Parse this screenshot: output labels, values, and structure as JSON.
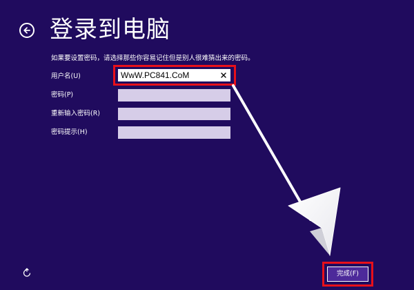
{
  "header": {
    "title": "登录到电脑"
  },
  "form": {
    "hint": "如果要设置密码，请选择那些你容易记住但是别人很难猜出来的密码。",
    "username_label": "用户名(U)",
    "username_value": "WwW.PC841.CoM",
    "password_label": "密码(P)",
    "password_value": "",
    "reenter_label": "重新输入密码(R)",
    "reenter_value": "",
    "hint_label": "密码提示(H)",
    "hint_value": ""
  },
  "footer": {
    "finish_label": "完成(F)"
  },
  "icons": {
    "back": "back-arrow-icon",
    "clear": "close-icon",
    "ease_of_access": "ease-of-access-icon"
  },
  "colors": {
    "background": "#200b5e",
    "field": "#d6cde8",
    "highlight": "#e8101a",
    "button": "#4d2a9a"
  }
}
